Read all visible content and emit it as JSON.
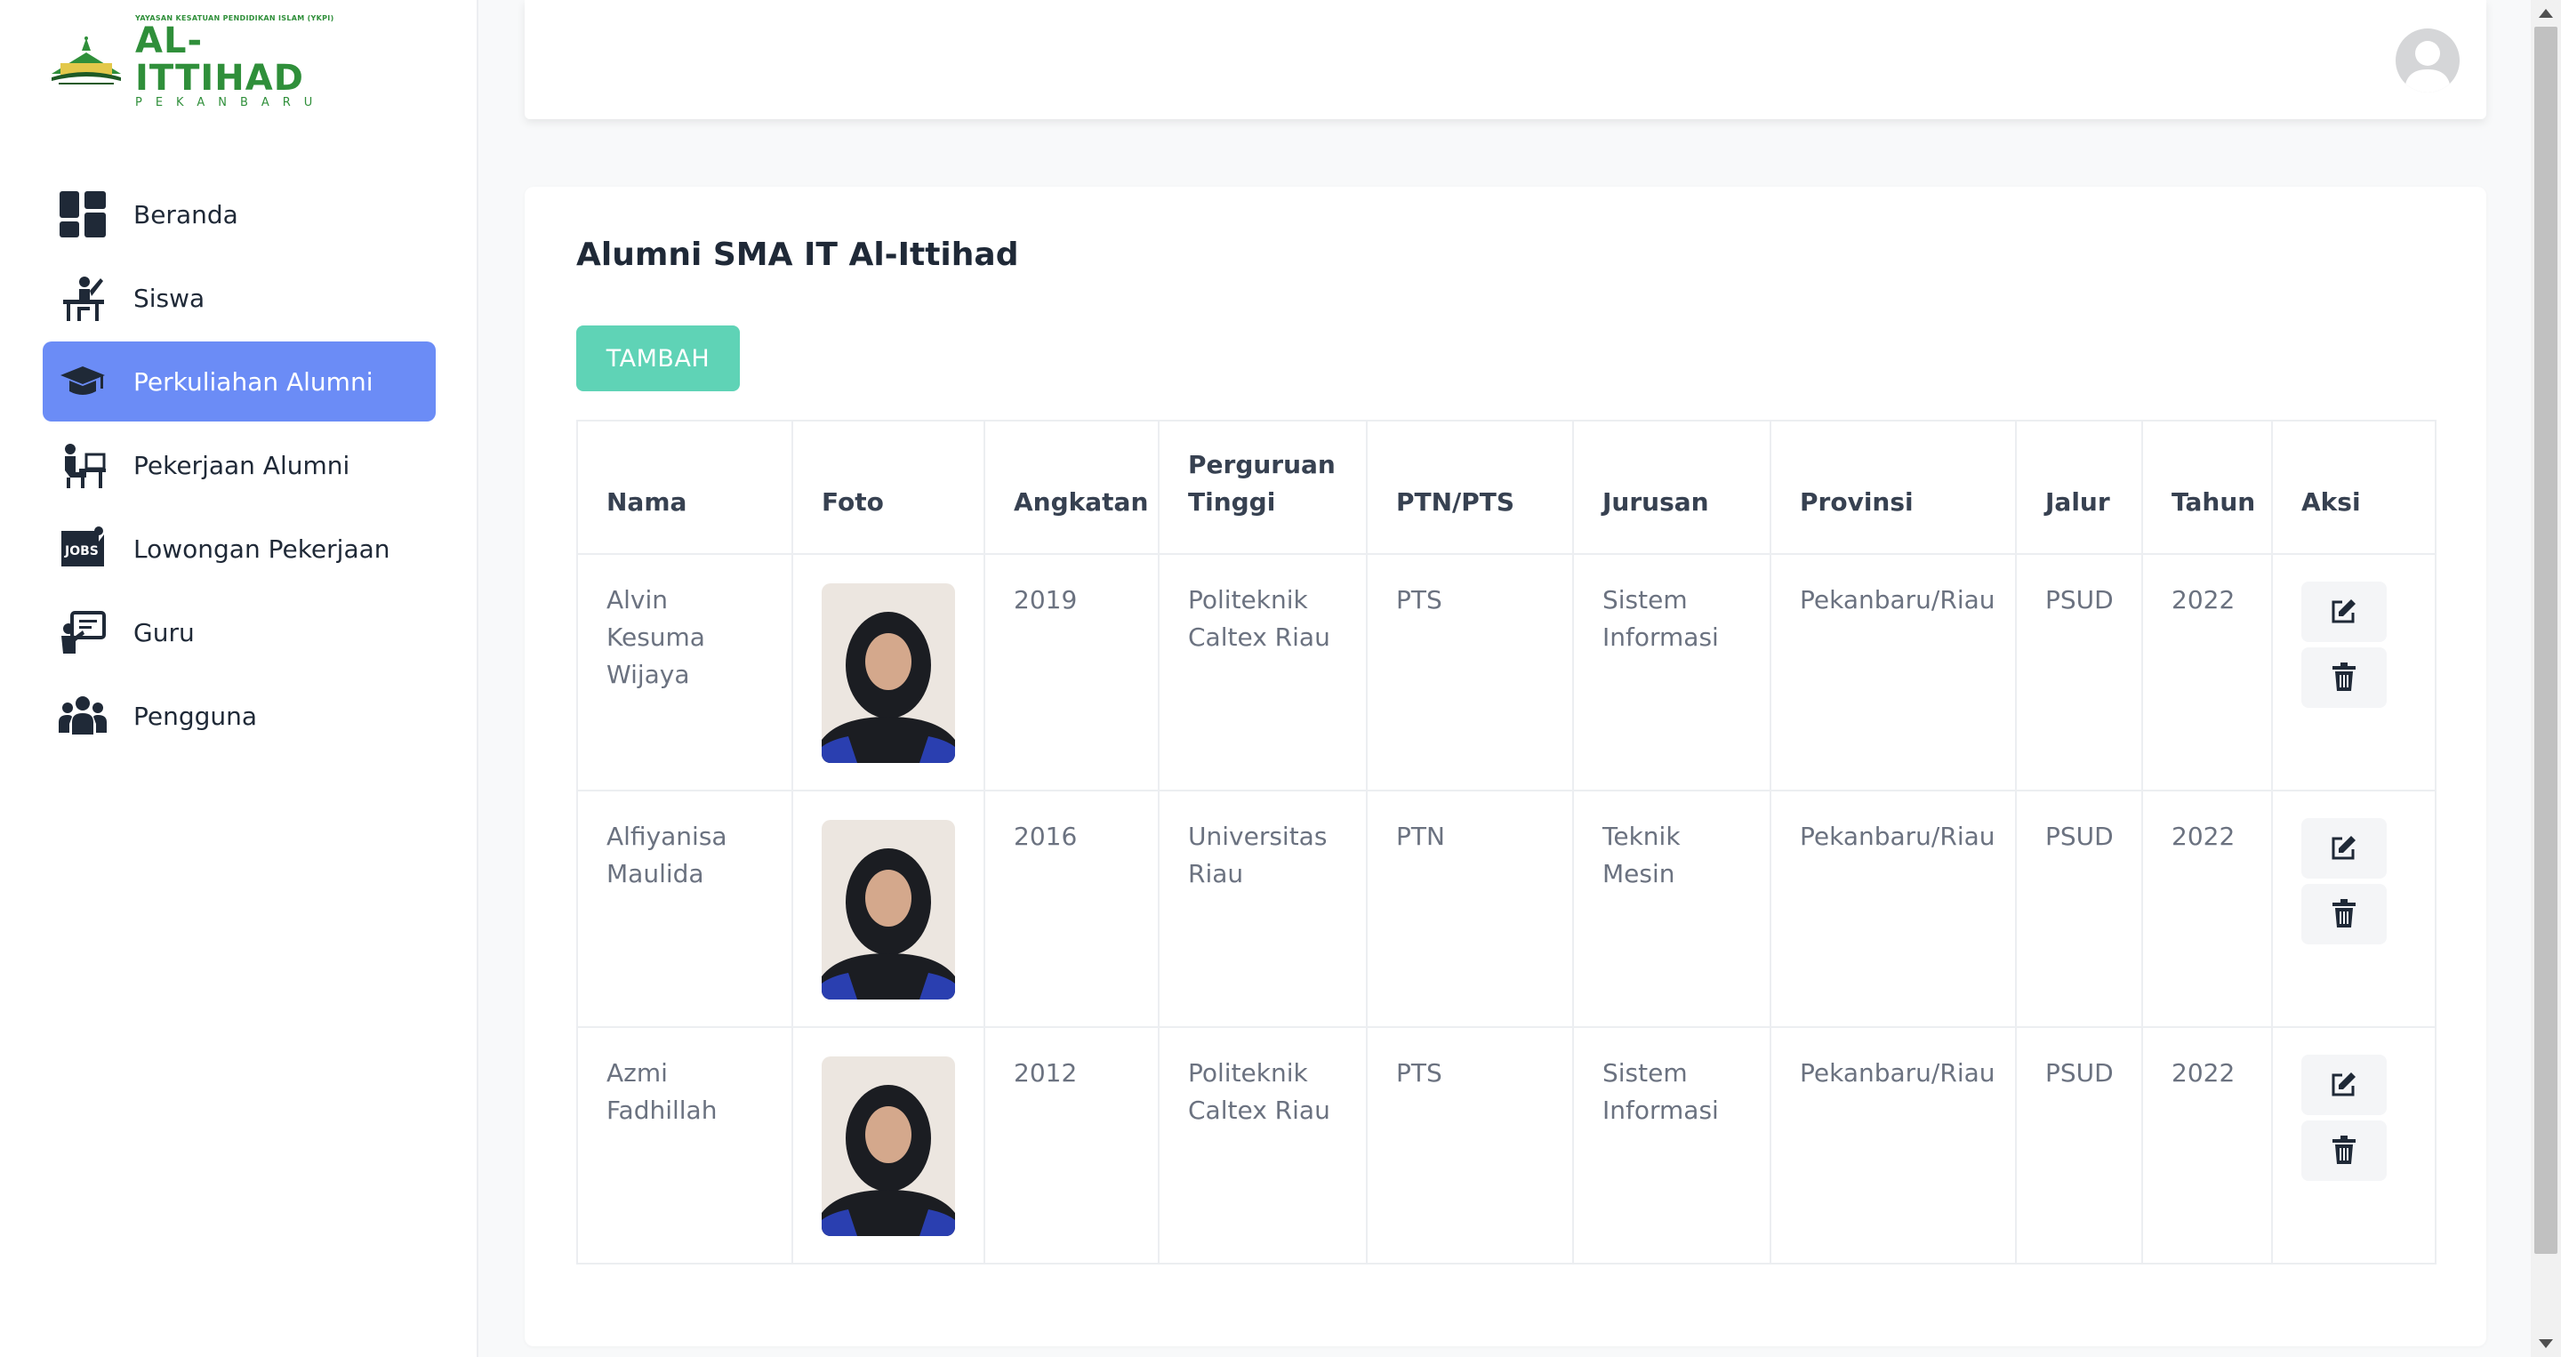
{
  "brand": {
    "small_text": "YAYASAN KESATUAN PENDIDIKAN ISLAM (YKPI)",
    "name": "AL-ITTIHAD",
    "city": "PEKANBARU",
    "accent": "#2f8f3a"
  },
  "sidebar": {
    "items": [
      {
        "label": "Beranda",
        "icon": "dashboard-icon"
      },
      {
        "label": "Siswa",
        "icon": "student-desk-icon"
      },
      {
        "label": "Perkuliahan Alumni",
        "icon": "graduation-cap-icon",
        "active": true
      },
      {
        "label": "Pekerjaan Alumni",
        "icon": "worker-laptop-icon"
      },
      {
        "label": "Lowongan Pekerjaan",
        "icon": "jobs-icon"
      },
      {
        "label": "Guru",
        "icon": "teacher-board-icon"
      },
      {
        "label": "Pengguna",
        "icon": "users-icon"
      }
    ],
    "active_color": "#6b8cf6"
  },
  "main": {
    "title": "Alumni SMA IT Al-Ittihad",
    "add_button": "TAMBAH",
    "add_button_color": "#5fd3b6",
    "table": {
      "headers": [
        "Nama",
        "Foto",
        "Angkatan",
        "Perguruan Tinggi",
        "PTN/PTS",
        "Jurusan",
        "Provinsi",
        "Jalur",
        "Tahun",
        "Aksi"
      ],
      "rows": [
        {
          "nama": "Alvin Kesuma Wijaya",
          "angkatan": "2019",
          "pt": "Politeknik Caltex Riau",
          "ptn_pts": "PTS",
          "jurusan": "Sistem Informasi",
          "provinsi": "Pekanbaru/Riau",
          "jalur": "PSUD",
          "tahun": "2022"
        },
        {
          "nama": "Alfiyanisa Maulida",
          "angkatan": "2016",
          "pt": "Universitas Riau",
          "ptn_pts": "PTN",
          "jurusan": "Teknik Mesin",
          "provinsi": "Pekanbaru/Riau",
          "jalur": "PSUD",
          "tahun": "2022"
        },
        {
          "nama": "Azmi Fadhillah",
          "angkatan": "2012",
          "pt": "Politeknik Caltex Riau",
          "ptn_pts": "PTS",
          "jurusan": "Sistem Informasi",
          "provinsi": "Pekanbaru/Riau",
          "jalur": "PSUD",
          "tahun": "2022"
        }
      ]
    }
  }
}
